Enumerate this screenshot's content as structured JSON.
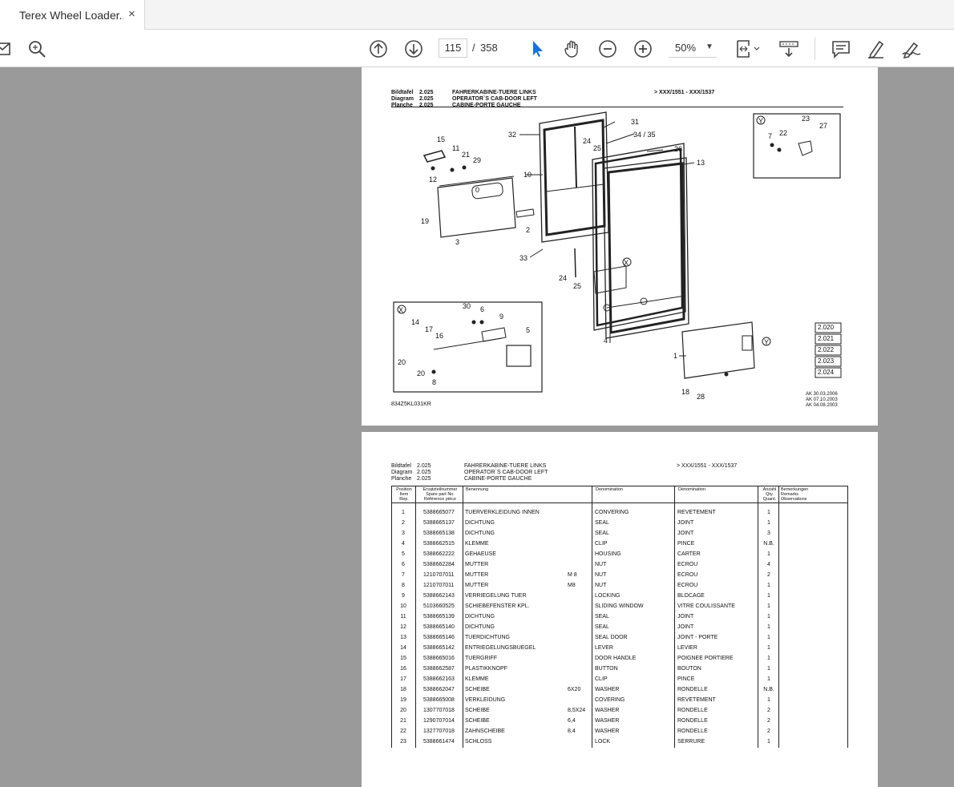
{
  "app": {
    "tab_title": "Terex Wheel Loader...",
    "tab_close": "×"
  },
  "toolbar": {
    "current_page": "115",
    "page_sep": "/",
    "total_pages": "358",
    "zoom": "50%",
    "icons": [
      "mail-icon",
      "search-icon",
      "page-up-icon",
      "page-down-icon",
      "select-pointer-icon",
      "hand-tool-icon",
      "zoom-out-icon",
      "zoom-in-icon",
      "fit-page-icon",
      "scroll-mode-icon",
      "comment-icon",
      "highlight-pen-icon",
      "sign-icon"
    ]
  },
  "page1": {
    "header": {
      "labels": [
        "Bildtafel",
        "Diagram",
        "Planche"
      ],
      "numbers": [
        "2.025",
        "2.025",
        "2.025"
      ],
      "titles": [
        "FAHRERKABINE-TUERE LINKS",
        "OPERATOR`S CAB-DOOR LEFT",
        "CABINE-PORTE GAUCHE"
      ],
      "range": "> XXX/1551   - XXX/1537"
    },
    "callouts": [
      "15",
      "11",
      "21",
      "29",
      "12",
      "0",
      "19",
      "3",
      "2",
      "32",
      "10",
      "24",
      "25",
      "31",
      "34 / 35",
      "26",
      "13",
      "33",
      "24",
      "25",
      "X",
      "23",
      "Y",
      "7",
      "22",
      "27",
      "X",
      "30",
      "6",
      "9",
      "14",
      "17",
      "16",
      "5",
      "20",
      "20",
      "8",
      "4",
      "1",
      "Y",
      "18",
      "28"
    ],
    "refs": [
      "2.020",
      "2.021",
      "2.022",
      "2.023",
      "2.024"
    ],
    "revisions": [
      "AK   30.03.2006",
      "AK   07.10.2003",
      "AK   04.08.2003"
    ],
    "drawing_code": "834Z5KL031KR"
  },
  "page2": {
    "header": {
      "labels": [
        "Bildtafel",
        "Diagram",
        "Planche"
      ],
      "numbers": [
        "2.025",
        "2.025",
        "2.025"
      ],
      "titles": [
        "FAHRERKABINE-TUERE LINKS",
        "OPERATOR`S CAB-DOOR LEFT",
        "CABINE-PORTE GAUCHE"
      ],
      "range": "> XXX/1551   - XXX/1537"
    },
    "columns": {
      "pos": [
        "Position",
        "Item",
        "Rep."
      ],
      "part": [
        "Ersatzteilnummer",
        "Spare part No.",
        "Référence pièce"
      ],
      "benennung": "Benennung",
      "denomination_en": "Denomination",
      "denomination_fr": "Dénomination",
      "qty": [
        "Anzahl",
        "Qty.",
        "Quant."
      ],
      "remarks": [
        "Bemerkungen",
        "Remarks",
        "Observations"
      ]
    },
    "rows": [
      {
        "pos": "1",
        "part": "5388665077",
        "de": "TUERVERKLEIDUNG INNEN",
        "size": "",
        "en": "CONVERING",
        "fr": "REVETEMENT",
        "qty": "1"
      },
      {
        "pos": "2",
        "part": "5388665137",
        "de": "DICHTUNG",
        "size": "",
        "en": "SEAL",
        "fr": "JOINT",
        "qty": "1"
      },
      {
        "pos": "3",
        "part": "5388665138",
        "de": "DICHTUNG",
        "size": "",
        "en": "SEAL",
        "fr": "JOINT",
        "qty": "3"
      },
      {
        "pos": "4",
        "part": "5388662515",
        "de": "KLEMME",
        "size": "",
        "en": "CLIP",
        "fr": "PINCE",
        "qty": "N.B."
      },
      {
        "pos": "5",
        "part": "5388662222",
        "de": "GEHAEUSE",
        "size": "",
        "en": "HOUSING",
        "fr": "CARTER",
        "qty": "1"
      },
      {
        "pos": "6",
        "part": "5388662284",
        "de": "MUTTER",
        "size": "",
        "en": "NUT",
        "fr": "ECROU",
        "qty": "4"
      },
      {
        "pos": "7",
        "part": "1210707011",
        "de": "MUTTER",
        "size": "M 8",
        "en": "NUT",
        "fr": "ECROU",
        "qty": "2"
      },
      {
        "pos": "8",
        "part": "1210707011",
        "de": "MUTTER",
        "size": "M8",
        "en": "NUT",
        "fr": "ECROU",
        "qty": "1"
      },
      {
        "pos": "9",
        "part": "5388662143",
        "de": "VERRIEGELUNG TUER",
        "size": "",
        "en": "LOCKING",
        "fr": "BLOCAGE",
        "qty": "1"
      },
      {
        "pos": "10",
        "part": "5103660525",
        "de": "SCHIEBEFENSTER KPL.",
        "size": "",
        "en": "SLIDING WINDOW",
        "fr": "VITRE COULISSANTE",
        "qty": "1"
      },
      {
        "pos": "11",
        "part": "5388665139",
        "de": "DICHTUNG",
        "size": "",
        "en": "SEAL",
        "fr": "JOINT",
        "qty": "1"
      },
      {
        "pos": "12",
        "part": "5388665140",
        "de": "DICHTUNG",
        "size": "",
        "en": "SEAL",
        "fr": "JOINT",
        "qty": "1"
      },
      {
        "pos": "13",
        "part": "5388665146",
        "de": "TUERDICHTUNG",
        "size": "",
        "en": "SEAL DOOR",
        "fr": "JOINT - PORTE",
        "qty": "1"
      },
      {
        "pos": "14",
        "part": "5388665142",
        "de": "ENTRIEGELUNGSBUEGEL",
        "size": "",
        "en": "LEVER",
        "fr": "LEVIER",
        "qty": "1"
      },
      {
        "pos": "15",
        "part": "5388665016",
        "de": "TUERGRIFF",
        "size": "",
        "en": "DOOR HANDLE",
        "fr": "POIGNEE PORTIERE",
        "qty": "1"
      },
      {
        "pos": "16",
        "part": "5388662587",
        "de": "PLASTIKKNOPF",
        "size": "",
        "en": "BUTTON",
        "fr": "BOUTON",
        "qty": "1"
      },
      {
        "pos": "17",
        "part": "5388662163",
        "de": "KLEMME",
        "size": "",
        "en": "CLIP",
        "fr": "PINCE",
        "qty": "1"
      },
      {
        "pos": "18",
        "part": "5388662047",
        "de": "SCHEIBE",
        "size": "6X20",
        "en": "WASHER",
        "fr": "RONDELLE",
        "qty": "N.B."
      },
      {
        "pos": "19",
        "part": "5388665008",
        "de": "VERKLEIDUNG",
        "size": "",
        "en": "COVERING",
        "fr": "REVETEMENT",
        "qty": "1"
      },
      {
        "pos": "20",
        "part": "1307707018",
        "de": "SCHEIBE",
        "size": "8,5X24",
        "en": "WASHER",
        "fr": "RONDELLE",
        "qty": "2"
      },
      {
        "pos": "21",
        "part": "1290707014",
        "de": "SCHEIBE",
        "size": "6,4",
        "en": "WASHER",
        "fr": "RONDELLE",
        "qty": "2"
      },
      {
        "pos": "22",
        "part": "1327707018",
        "de": "ZAHNSCHEIBE",
        "size": "8,4",
        "en": "WASHER",
        "fr": "RONDELLE",
        "qty": "2"
      },
      {
        "pos": "23",
        "part": "5388661474",
        "de": "SCHLOSS",
        "size": "",
        "en": "LOCK",
        "fr": "SERRURE",
        "qty": "1"
      }
    ]
  },
  "colors": {
    "viewer_bg": "#9a9a9a",
    "toolbar_bg": "#ffffff",
    "accent_pointer": "#1473e6"
  }
}
